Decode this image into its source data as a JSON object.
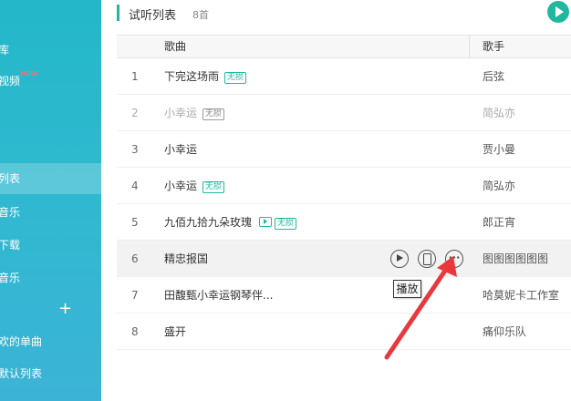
{
  "sidebar": {
    "items": [
      {
        "label": "库"
      },
      {
        "label": "视频",
        "badge": "NEW"
      },
      {
        "label": "列表"
      },
      {
        "label": "音乐"
      },
      {
        "label": "下载"
      },
      {
        "label": "音乐"
      },
      {
        "label": ""
      },
      {
        "label": "欢的单曲"
      },
      {
        "label": "默认列表"
      }
    ],
    "plus_icon": "+"
  },
  "playlist": {
    "title": "试听列表",
    "count": "8首",
    "play_all_icon": "play-circle-icon"
  },
  "table": {
    "columns": {
      "song": "歌曲",
      "artist": "歌手"
    },
    "rows": [
      {
        "num": "1",
        "song": "下完这场雨",
        "badge": "无损",
        "artist": "后弦"
      },
      {
        "num": "2",
        "song": "小幸运",
        "badge": "无损",
        "artist": "简弘亦"
      },
      {
        "num": "3",
        "song": "小幸运",
        "badge": "",
        "artist": "贾小曼"
      },
      {
        "num": "4",
        "song": "小幸运",
        "badge": "无损",
        "artist": "简弘亦"
      },
      {
        "num": "5",
        "song": "九佰九拾九朵玫瑰",
        "badge": "无损",
        "artist": "郎正宵"
      },
      {
        "num": "6",
        "song": "精忠报国",
        "badge": "",
        "artist": "图图图图图图"
      },
      {
        "num": "7",
        "song": "田馥甄小幸运钢琴伴...",
        "badge": "",
        "artist": "哈莫妮卡工作室"
      },
      {
        "num": "8",
        "song": "盛开",
        "badge": "",
        "artist": "痛仰乐队"
      }
    ]
  },
  "row_controls": {
    "more_glyph": "···"
  },
  "tooltip": {
    "text": "播放"
  },
  "colors": {
    "accent": "#1fb89e",
    "sidebar": "#2db8cc",
    "arrow": "#e8383d"
  }
}
